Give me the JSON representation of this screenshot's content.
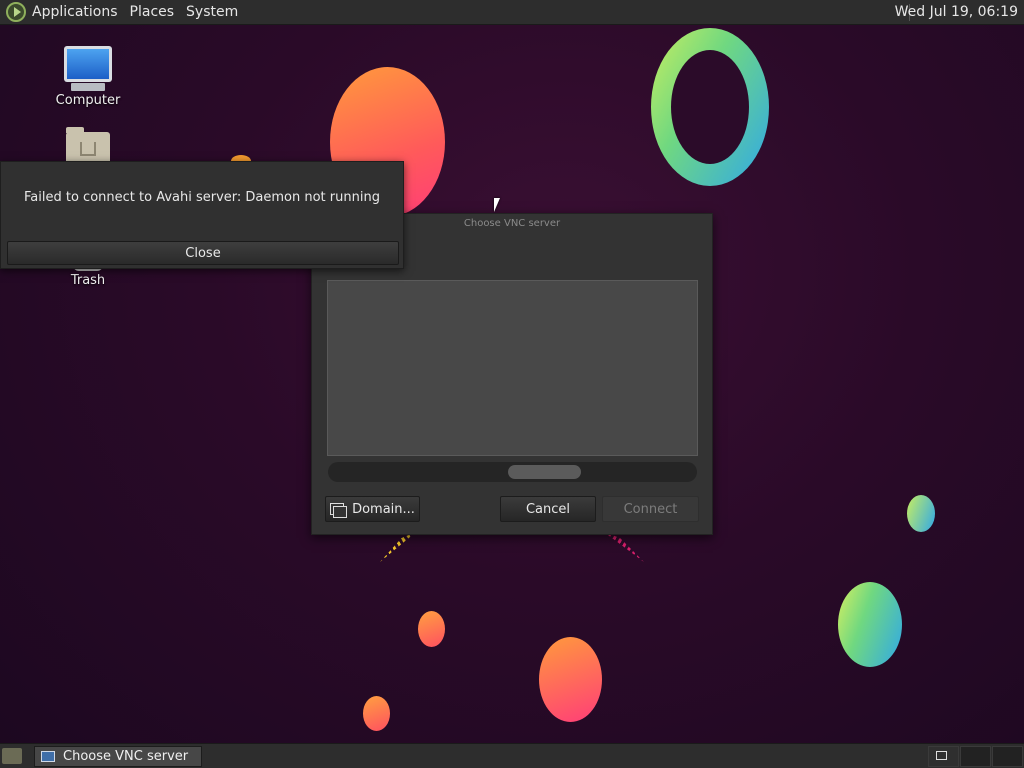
{
  "top_panel": {
    "menus": [
      "Applications",
      "Places",
      "System"
    ],
    "clock": "Wed Jul 19, 06:19"
  },
  "desktop": {
    "icons": [
      {
        "label": "Computer",
        "icon": "computer-icon"
      },
      {
        "label": "",
        "icon": "home-folder-icon"
      },
      {
        "label": "Trash",
        "icon": "trash-icon"
      }
    ]
  },
  "error_popup": {
    "message": "Failed to connect to Avahi server: Daemon not running",
    "close_label": "Close"
  },
  "vnc_dialog": {
    "title": "Choose VNC server",
    "domain_label": "Domain...",
    "cancel_label": "Cancel",
    "connect_label": "Connect"
  },
  "bottom_panel": {
    "task_label": "Choose VNC server"
  },
  "colors": {
    "panel": "#2d2d2d",
    "wallpaper": "#2a0a28",
    "dialog": "#333333"
  }
}
